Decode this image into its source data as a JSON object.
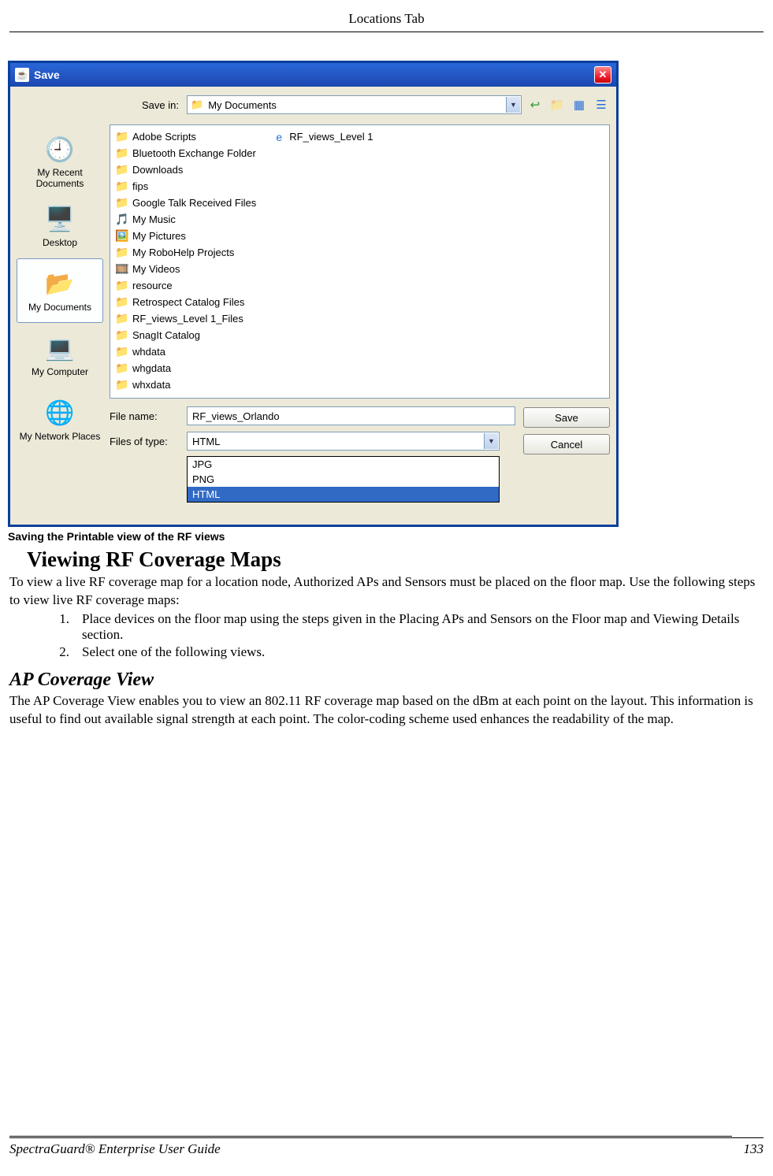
{
  "header": {
    "tab_title": "Locations Tab"
  },
  "dialog": {
    "title": "Save",
    "save_in_label": "Save in:",
    "save_in_value": "My Documents",
    "places": [
      {
        "label": "My Recent Documents"
      },
      {
        "label": "Desktop"
      },
      {
        "label": "My Documents"
      },
      {
        "label": "My Computer"
      },
      {
        "label": "My Network Places"
      }
    ],
    "files_col1": [
      "Adobe Scripts",
      "Bluetooth Exchange Folder",
      "Downloads",
      "fips",
      "Google Talk Received Files",
      "My Music",
      "My Pictures",
      "My RoboHelp Projects",
      "My Videos",
      "resource",
      "Retrospect Catalog Files",
      "RF_views_Level 1_Files",
      "SnagIt Catalog",
      "whdata",
      "whgdata",
      "whxdata"
    ],
    "files_col2": [
      "RF_views_Level 1"
    ],
    "file_name_label": "File name:",
    "file_name_value": "RF_views_Orlando",
    "file_type_label": "Files of type:",
    "file_type_value": "HTML",
    "file_type_options": [
      "JPG",
      "PNG",
      "HTML"
    ],
    "save_button": "Save",
    "cancel_button": "Cancel"
  },
  "caption": "Saving the Printable view of the RF views",
  "section1": {
    "heading": "Viewing RF Coverage Maps",
    "p1": "To view a live RF coverage map for a location node, Authorized APs and Sensors must be placed on the floor map. Use the following steps to view live RF coverage maps:",
    "steps": [
      "Place devices on the floor map using the steps given in the Placing APs and Sensors on the Floor map and Viewing Details section.",
      "Select one of the following views."
    ]
  },
  "section2": {
    "heading": "AP Coverage View",
    "p1": "The AP Coverage View enables you to view an 802.11 RF coverage map based on the dBm at each point on the layout. This information is useful to find out available signal strength at each point. The color-coding scheme used enhances the readability of the map."
  },
  "footer": {
    "left": "SpectraGuard® Enterprise User Guide",
    "right": "133"
  }
}
